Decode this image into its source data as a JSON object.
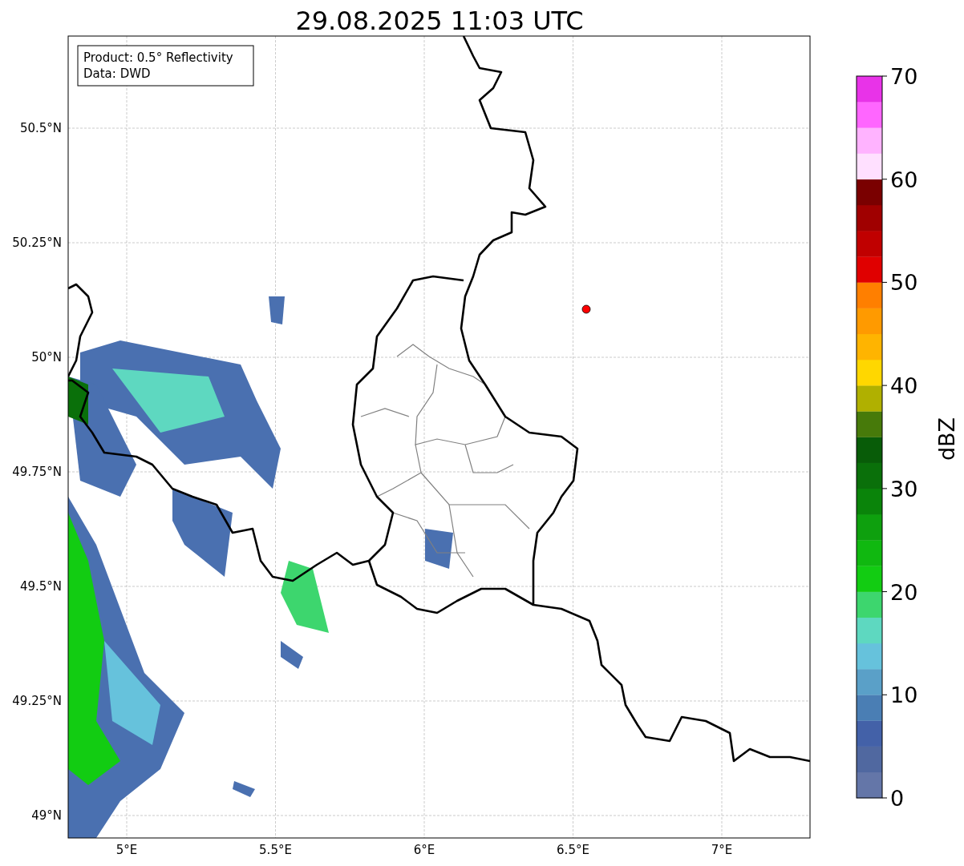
{
  "title": "29.08.2025 11:03 UTC",
  "info_box": {
    "lines": [
      "Product: 0.5° Reflectivity",
      "Data: DWD"
    ]
  },
  "map": {
    "lat_ticks": [
      "50.5°N",
      "50.25°N",
      "50°N",
      "49.75°N",
      "49.5°N",
      "49.25°N",
      "49°N"
    ],
    "lon_ticks": [
      "5°E",
      "5.5°E",
      "6°E",
      "6.5°E",
      "7°E"
    ]
  },
  "colorbar": {
    "label": "dBZ",
    "ticks": [
      "70",
      "60",
      "50",
      "40",
      "30",
      "20",
      "10",
      "0"
    ],
    "bins": [
      {
        "color": "#6476a8"
      },
      {
        "color": "#5068a0"
      },
      {
        "color": "#4361a8"
      },
      {
        "color": "#4a7eb4"
      },
      {
        "color": "#5aa0c8"
      },
      {
        "color": "#66c2dc"
      },
      {
        "color": "#5ed8c0"
      },
      {
        "color": "#3dd66e"
      },
      {
        "color": "#12cc12"
      },
      {
        "color": "#10b810"
      },
      {
        "color": "#0ea00e"
      },
      {
        "color": "#0a840a"
      },
      {
        "color": "#0a700a"
      },
      {
        "color": "#085c08"
      },
      {
        "color": "#477a0a"
      },
      {
        "color": "#b0b000"
      },
      {
        "color": "#ffd700"
      },
      {
        "color": "#ffb400"
      },
      {
        "color": "#ff9a00"
      },
      {
        "color": "#ff7f00"
      },
      {
        "color": "#e00000"
      },
      {
        "color": "#c00000"
      },
      {
        "color": "#a00000"
      },
      {
        "color": "#7a0000"
      },
      {
        "color": "#ffe0ff"
      },
      {
        "color": "#ffb3ff"
      },
      {
        "color": "#ff66ff"
      },
      {
        "color": "#e833e8"
      }
    ]
  }
}
